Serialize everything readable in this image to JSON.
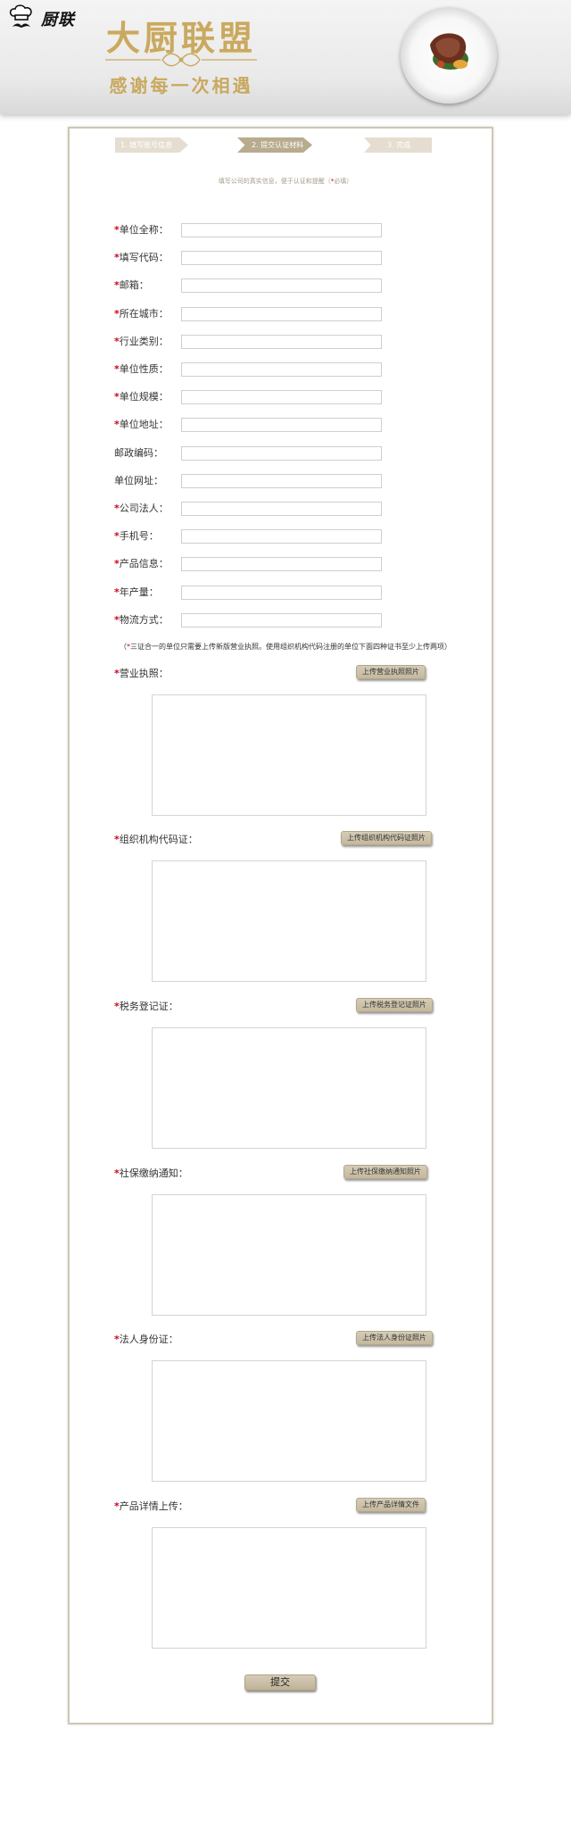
{
  "brand": {
    "logo_text": "厨联"
  },
  "banner": {
    "title": "大厨联盟",
    "subtitle": "感谢每一次相遇"
  },
  "steps": [
    {
      "label": "1. 填写账号信息",
      "state": "done"
    },
    {
      "label": "2. 提交认证材料",
      "state": "active"
    },
    {
      "label": "3. 完成",
      "state": "pending"
    }
  ],
  "intro": {
    "text": "填写公司的真实信息，便于认证和提醒（",
    "required_mark": "*",
    "text_end": "必填）"
  },
  "fields": [
    {
      "label": "单位全称：",
      "required": true,
      "value": ""
    },
    {
      "label": "填写代码：",
      "required": true,
      "value": ""
    },
    {
      "label": "邮箱：",
      "required": true,
      "value": ""
    },
    {
      "label": "所在城市：",
      "required": true,
      "value": ""
    },
    {
      "label": "行业类别：",
      "required": true,
      "value": ""
    },
    {
      "label": "单位性质：",
      "required": true,
      "value": ""
    },
    {
      "label": "单位规模：",
      "required": true,
      "value": ""
    },
    {
      "label": "单位地址：",
      "required": true,
      "value": ""
    },
    {
      "label": "邮政编码：",
      "required": false,
      "value": ""
    },
    {
      "label": "单位网址：",
      "required": false,
      "value": ""
    },
    {
      "label": "公司法人：",
      "required": true,
      "value": ""
    },
    {
      "label": "手机号：",
      "required": true,
      "value": ""
    },
    {
      "label": "产品信息：",
      "required": true,
      "value": ""
    },
    {
      "label": "年产量：",
      "required": true,
      "value": ""
    },
    {
      "label": "物流方式：",
      "required": true,
      "value": ""
    }
  ],
  "note": {
    "open": "（",
    "star": "*",
    "text": "三证合一的单位只需要上传新版营业执照。使用组织机构代码注册的单位下面四种证书至少上传两项）"
  },
  "uploads": [
    {
      "label": "营业执照：",
      "button": "上传营业执照照片"
    },
    {
      "label": "组织机构代码证：",
      "button": "上传组织机构代码证照片"
    },
    {
      "label": "税务登记证：",
      "button": "上传税务登记证照片"
    },
    {
      "label": "社保缴纳通知：",
      "button": "上传社保缴纳通知照片"
    },
    {
      "label": "法人身份证：",
      "button": "上传法人身份证照片"
    },
    {
      "label": "产品详情上传：",
      "button": "上传产品详情文件"
    }
  ],
  "submit_label": "提交",
  "colors": {
    "gold": "#c9a961",
    "step_active": "#b8ab8e",
    "step_inactive": "#e5ded0",
    "required": "#d0021b",
    "button": "#c4b89d"
  }
}
